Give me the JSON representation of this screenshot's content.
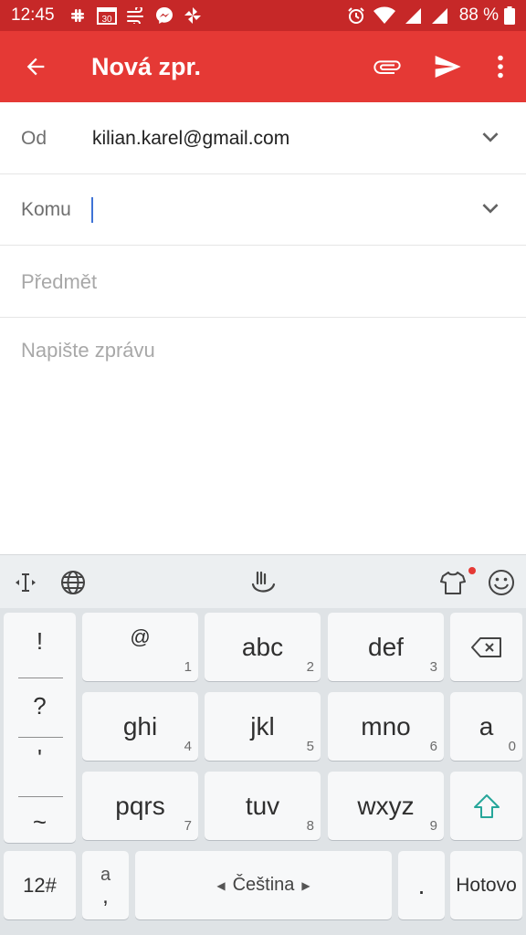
{
  "status_bar": {
    "time": "12:45",
    "calendar_day": "30",
    "battery": "88 %",
    "icons": [
      "slack-icon",
      "calendar-icon",
      "wind-icon",
      "messenger-icon",
      "pinwheel-icon",
      "alarm-icon",
      "wifi-icon",
      "signal-icon",
      "signal-icon",
      "battery-icon"
    ]
  },
  "app_bar": {
    "title": "Nová zpr.",
    "actions": [
      "attach-icon",
      "send-icon",
      "more-vert-icon"
    ],
    "color": "#e53935"
  },
  "compose": {
    "from_label": "Od",
    "from_value": "kilian.karel@gmail.com",
    "to_label": "Komu",
    "subject_placeholder": "Předmět",
    "body_placeholder": "Napište zprávu"
  },
  "keyboard": {
    "toolbar_icons": [
      "cursor-icon",
      "globe-icon",
      "gesture-icon",
      "theme-shirt-icon",
      "emoji-icon"
    ],
    "punctuation": [
      "!",
      "?",
      "'",
      "~"
    ],
    "rows": [
      [
        {
          "label": "@",
          "num": "1"
        },
        {
          "label": "abc",
          "num": "2"
        },
        {
          "label": "def",
          "num": "3"
        }
      ],
      [
        {
          "label": "ghi",
          "num": "4"
        },
        {
          "label": "jkl",
          "num": "5"
        },
        {
          "label": "mno",
          "num": "6"
        }
      ],
      [
        {
          "label": "pqrs",
          "num": "7"
        },
        {
          "label": "tuv",
          "num": "8"
        },
        {
          "label": "wxyz",
          "num": "9"
        }
      ]
    ],
    "right_keys": {
      "a_label": "a",
      "a_num": "0"
    },
    "bottom": {
      "sym_label": "12#",
      "comma_top": "a",
      "comma_bottom": ",",
      "space_label": "Čeština",
      "period": ".",
      "done_label": "Hotovo"
    },
    "accent_shift": "#26a69a",
    "notify_dot": "#e53935"
  }
}
